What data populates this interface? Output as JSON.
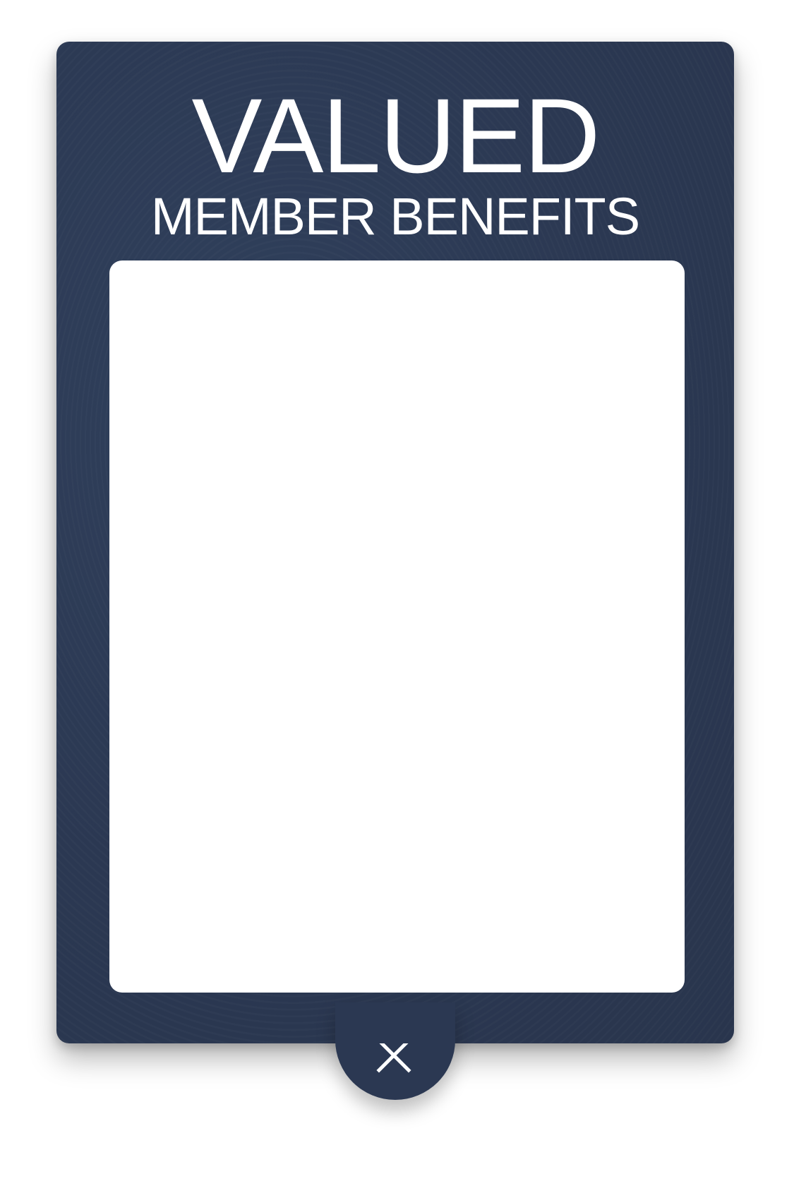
{
  "popup": {
    "title_main": "VALUED",
    "title_sub": "MEMBER BENEFITS"
  },
  "close_button": {
    "icon": "close-icon",
    "label": "Close"
  },
  "colors": {
    "card_background": "#2b3852",
    "panel_background": "#ffffff",
    "text": "#ffffff"
  }
}
